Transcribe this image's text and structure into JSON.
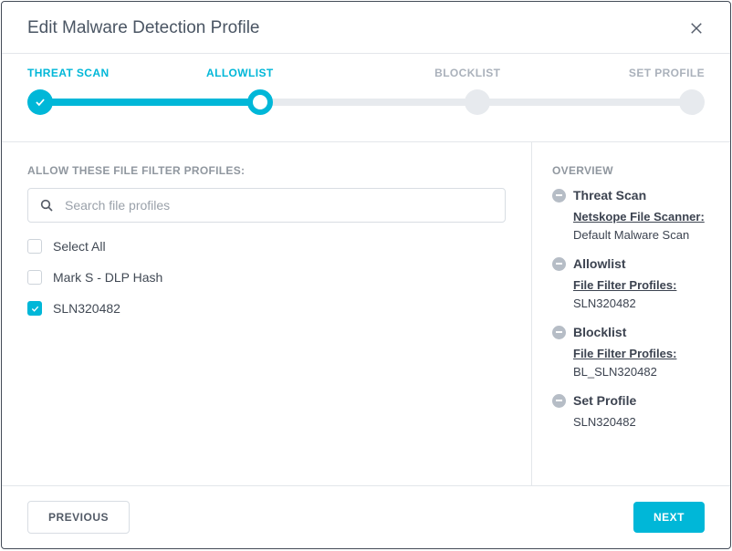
{
  "modal": {
    "title": "Edit Malware Detection Profile"
  },
  "stepper": {
    "steps": [
      {
        "label": "THREAT SCAN"
      },
      {
        "label": "ALLOWLIST"
      },
      {
        "label": "BLOCKLIST"
      },
      {
        "label": "SET PROFILE"
      }
    ]
  },
  "left": {
    "heading": "ALLOW THESE FILE FILTER PROFILES:",
    "search_placeholder": "Search file profiles",
    "items": [
      {
        "label": "Select All"
      },
      {
        "label": "Mark S - DLP Hash"
      },
      {
        "label": "SLN320482"
      }
    ]
  },
  "overview": {
    "heading": "OVERVIEW",
    "sections": [
      {
        "title": "Threat Scan",
        "link": "Netskope File Scanner:",
        "value": "Default Malware Scan"
      },
      {
        "title": "Allowlist",
        "link": "File Filter Profiles:",
        "value": "SLN320482"
      },
      {
        "title": "Blocklist",
        "link": "File Filter Profiles:",
        "value": "BL_SLN320482"
      },
      {
        "title": "Set Profile",
        "link": "",
        "value": "SLN320482"
      }
    ]
  },
  "footer": {
    "previous": "PREVIOUS",
    "next": "NEXT"
  }
}
